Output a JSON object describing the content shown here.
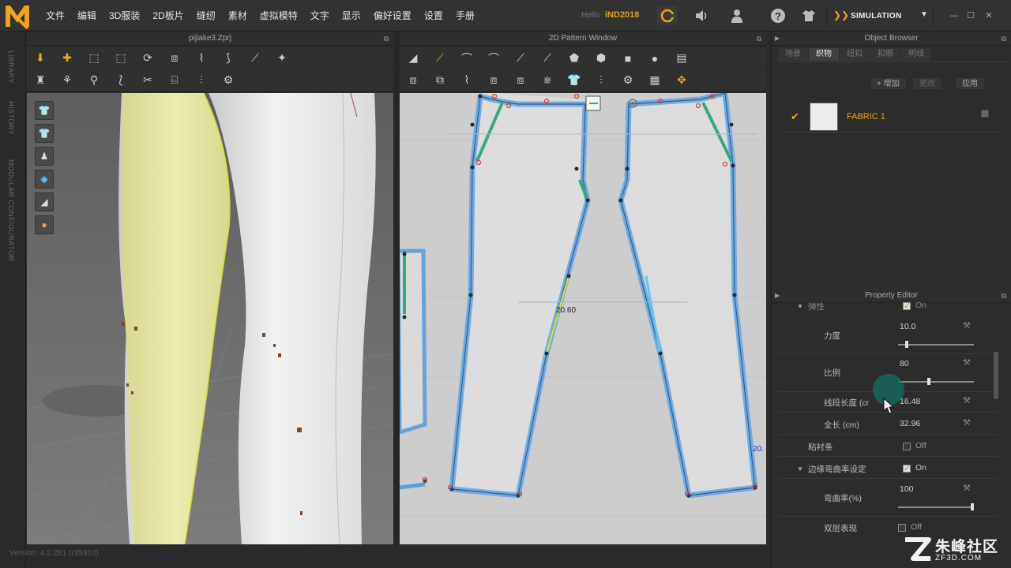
{
  "menubar": {
    "items": [
      "文件",
      "编辑",
      "3D服装",
      "2D板片",
      "缝纫",
      "素材",
      "虚拟模特",
      "文字",
      "显示",
      "偏好设置",
      "设置",
      "手册"
    ],
    "hello_label": "Hello",
    "username": "iND2018",
    "simulation_label": "SIMULATION"
  },
  "left_strip": {
    "tabs": [
      "LIBRARY",
      "HISTORY",
      "MODULAR CONFIGURATOR"
    ]
  },
  "view3d": {
    "title": "pijiake3.Zprj"
  },
  "view2d": {
    "title": "2D Pattern Window",
    "measure_label": "20.60",
    "edge_label": "20."
  },
  "object_browser": {
    "title": "Object Browser",
    "tabs": [
      "场景",
      "织物",
      "纽扣",
      "扣眼",
      "明线"
    ],
    "active_tab": "织物",
    "buttons": {
      "add": "+ 增加",
      "replace": "更改",
      "apply": "应用"
    },
    "fabric": {
      "name": "FABRIC 1",
      "color": "#ececec"
    }
  },
  "property_editor": {
    "title": "Property Editor",
    "elastic_section": "弹性",
    "elastic_state": "On",
    "strength_label": "力度",
    "strength_value": "10.0",
    "strength_fraction": 0.1,
    "ratio_label": "比例",
    "ratio_value": "80",
    "ratio_fraction": 0.4,
    "segment_label": "线段长度 (cr",
    "segment_value": "16.48",
    "total_label": "全长 (cm)",
    "total_value": "32.96",
    "tape_label": "粘衬条",
    "tape_state": "Off",
    "curvature_section": "边缘弯曲率设定",
    "curvature_state": "On",
    "curvature_label": "弯曲率(%)",
    "curvature_value": "100",
    "curvature_fraction": 1.0,
    "double_label": "双层表现",
    "double_state": "Off"
  },
  "footer": {
    "version": "Version: 4.2.281 (r35910)"
  },
  "watermark": {
    "text": "朱峰社区",
    "url": "ZF3D.COM"
  },
  "colors": {
    "accent": "#f0a418",
    "pattern_edge": "#5d9fd8",
    "seam_green": "#3aa87a",
    "yellow_leg": "#dfe29a"
  }
}
